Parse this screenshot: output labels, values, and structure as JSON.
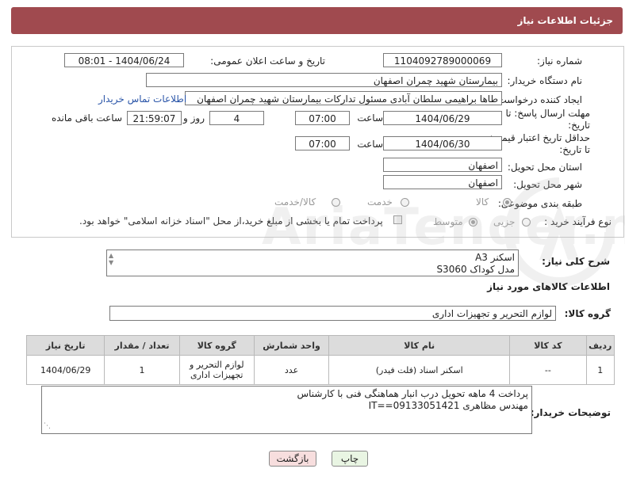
{
  "header": {
    "title": "جزئیات اطلاعات نیاز"
  },
  "fields": {
    "need_number_label": "شماره نیاز:",
    "need_number": "1104092789000069",
    "announce_label": "تاریخ و ساعت اعلان عمومی:",
    "announce_value": "1404/06/24 - 08:01",
    "buyer_org_label": "نام دستگاه خریدار:",
    "buyer_org": "بیمارستان شهید چمران اصفهان",
    "requester_label": "ایجاد کننده درخواست:",
    "requester": "طاها براهیمی سلطان آبادی مسئول تدارکات  بیمارستان شهید چمران اصفهان",
    "buyer_contact_link": "اطلاعات تماس خریدار",
    "deadline_label_1": "مهلت ارسال پاسخ: تا",
    "deadline_label_2": "تاریخ:",
    "deadline_date": "1404/06/29",
    "hour_label": "ساعت",
    "deadline_time": "07:00",
    "days_value": "4",
    "days_label": "روز و",
    "remaining_time": "21:59:07",
    "remaining_label": "ساعت باقی مانده",
    "validity_label_1": "حداقل تاریخ اعتبار قیمت:",
    "validity_label_2": "تا تاریخ:",
    "validity_date": "1404/06/30",
    "validity_time": "07:00",
    "province_label": "استان محل تحویل:",
    "province": "اصفهان",
    "city_label": "شهر محل تحویل:",
    "city": "اصفهان",
    "category_label": "طبقه بندی موضوعی:",
    "category_options": [
      "کالا",
      "خدمت",
      "کالا/خدمت"
    ],
    "category_selected": "کالا",
    "process_label": "نوع فرآیند خرید :",
    "process_options": [
      "جزیی",
      "متوسط"
    ],
    "process_selected": "متوسط",
    "payment_note": "پرداخت تمام یا بخشی از مبلغ خرید،از محل \"اسناد خزانه اسلامی\" خواهد بود."
  },
  "description": {
    "label": "شرح کلی نیاز:",
    "lines": [
      "اسکنر A3",
      "مدل کوداک S3060"
    ]
  },
  "goods_info_title": "اطلاعات کالاهای مورد نیاز",
  "goods_group": {
    "label": "گروه کالا:",
    "value": "لوازم التحریر و تجهیزات اداری"
  },
  "table": {
    "headers": [
      "ردیف",
      "کد کالا",
      "نام کالا",
      "واحد شمارش",
      "گروه کالا",
      "تعداد / مقدار",
      "تاریخ نیاز"
    ],
    "rows": [
      [
        "1",
        "--",
        "اسکنر اسناد (فلت فیدر)",
        "عدد",
        "لوازم التحریر و تجهیزات اداری",
        "1",
        "1404/06/29"
      ]
    ]
  },
  "buyer_notes": {
    "label": "توضیحات خریدار:",
    "lines": [
      "پرداخت 4 ماهه تحویل درب انبار هماهنگی فنی با کارشناس",
      "مهندس مظاهری 09133051421==IT"
    ]
  },
  "buttons": {
    "print": "چاپ",
    "back": "بازگشت"
  },
  "watermark": {
    "text": "AriaTender.net"
  },
  "colors": {
    "header_bg": "#a04a4f",
    "link": "#2a55a8",
    "print_bg": "#e9f5e3",
    "back_bg": "#f7dede"
  }
}
